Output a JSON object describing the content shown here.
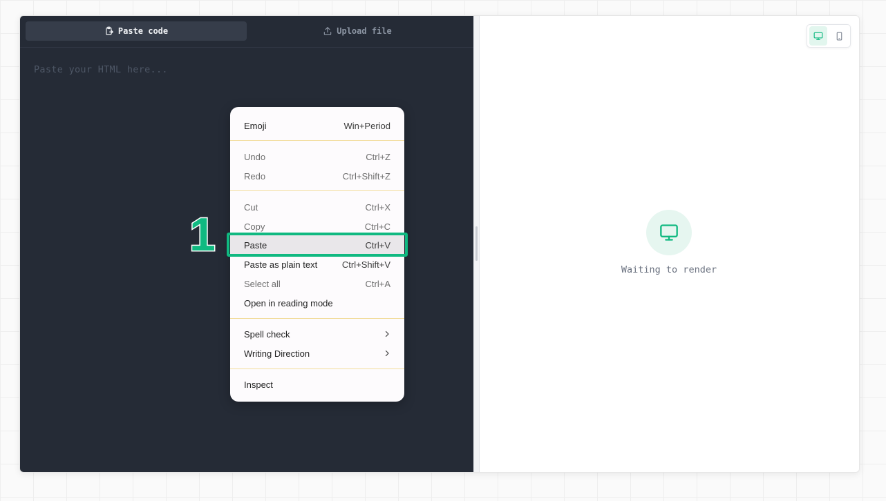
{
  "editor": {
    "tabs": [
      {
        "label": "Paste code",
        "icon": "clipboard-paste-icon",
        "active": true
      },
      {
        "label": "Upload file",
        "icon": "upload-icon",
        "active": false
      }
    ],
    "placeholder": "Paste your HTML here..."
  },
  "preview": {
    "device_toggle": [
      {
        "icon": "desktop-icon",
        "active": true
      },
      {
        "icon": "mobile-icon",
        "active": false
      }
    ],
    "status_icon": "monitor-icon",
    "status_text": "Waiting to render"
  },
  "context_menu": {
    "items": [
      {
        "label": "Emoji",
        "shortcut": "Win+Period",
        "enabled": true
      },
      {
        "label": "Undo",
        "shortcut": "Ctrl+Z",
        "enabled": false
      },
      {
        "label": "Redo",
        "shortcut": "Ctrl+Shift+Z",
        "enabled": false
      },
      {
        "label": "Cut",
        "shortcut": "Ctrl+X",
        "enabled": false
      },
      {
        "label": "Copy",
        "shortcut": "Ctrl+C",
        "enabled": false
      },
      {
        "label": "Paste",
        "shortcut": "Ctrl+V",
        "enabled": true,
        "highlighted": true
      },
      {
        "label": "Paste as plain text",
        "shortcut": "Ctrl+Shift+V",
        "enabled": true
      },
      {
        "label": "Select all",
        "shortcut": "Ctrl+A",
        "enabled": false
      },
      {
        "label": "Open in reading mode",
        "shortcut": "",
        "enabled": true
      },
      {
        "label": "Spell check",
        "shortcut": "",
        "enabled": true,
        "submenu": true
      },
      {
        "label": "Writing Direction",
        "shortcut": "",
        "enabled": true,
        "submenu": true
      },
      {
        "label": "Inspect",
        "shortcut": "",
        "enabled": true
      }
    ]
  },
  "annotation": {
    "step_number": "1",
    "color": "#10b981"
  },
  "colors": {
    "editor_bg": "#252b36",
    "accent": "#10b981",
    "menu_separator": "#f2dc9a"
  }
}
